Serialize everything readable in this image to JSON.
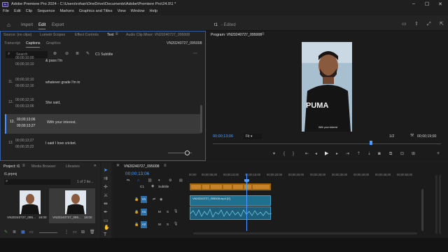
{
  "window": {
    "title": "Adobe Premiere Pro 2024 - C:\\Users\\rohan\\OneDrive\\Documents\\Adobe\\Premiere Pro\\24.0\\1 *",
    "minimize": "–",
    "maximize": "☐",
    "close": "✕"
  },
  "menu": [
    "File",
    "Edit",
    "Clip",
    "Sequence",
    "Markers",
    "Graphics and Titles",
    "View",
    "Window",
    "Help"
  ],
  "header": {
    "tabs": [
      "Import",
      "Edit",
      "Export"
    ],
    "active_tab": "Edit",
    "project_name": "t1",
    "project_status": "- Edited"
  },
  "source_panel": {
    "tabs": [
      "Source: (no clips)",
      "Lumetri Scopes",
      "Effect Controls",
      "Text",
      "Audio Clip Mixer: VN20240727_095008"
    ],
    "subtabs": [
      "Transcript",
      "Captions",
      "Graphics"
    ],
    "sequence": "VN20240727_095008",
    "search_placeholder": "Search",
    "track_label": "C1 Subtitle",
    "captions": [
      {
        "num": "",
        "in": "00;00;10;00",
        "out": "00;00;10;10",
        "text": "& pass I'm"
      },
      {
        "num": "11.",
        "in": "00;00;10;10",
        "out": "00;00;12;16",
        "text": "whatever grade I'm in"
      },
      {
        "num": "12.",
        "in": "00;00;12;16",
        "out": "00;00;13;06",
        "text": "She said,"
      },
      {
        "num": "12.",
        "in": "00;00;13;06",
        "out": "00;00;13;27",
        "text": "With your interest,"
      },
      {
        "num": "13.",
        "in": "00;00;13;27",
        "out": "00;00;15;22",
        "text": "I said I love cricket."
      }
    ]
  },
  "program": {
    "title": "Program: VN20240727_095008",
    "timecode": "00;00;13;06",
    "fit": "Fit",
    "quality": "1/2",
    "duration": "00;00;19;00",
    "video_caption": "With your interest",
    "shirt_brand": "PUMA"
  },
  "project_panel": {
    "tabs": [
      "Project: t1",
      "Media Browser",
      "Libraries"
    ],
    "file": "t1.prproj",
    "count": "1 of 2 ite...",
    "items": [
      {
        "name": "VN20240727_095...",
        "duration": "19:00"
      },
      {
        "name": "VN20240727_095...",
        "duration": "19:00"
      }
    ]
  },
  "timeline": {
    "sequence": "VN20240727_095008",
    "timecode": "00;00;13;06",
    "ruler": [
      "00;00",
      "00;00;05;00",
      "00;00;10;00",
      "00;00;15;00",
      "00;00;20;00",
      "00;00;25;00",
      "00;00;30;00",
      "00;00;35;00",
      "00;00;40;00",
      "00;00;45;00",
      "00;00;50;00"
    ],
    "tracks": [
      {
        "label": "C1",
        "name": "Subtitle"
      },
      {
        "label": "V1",
        "name": ""
      },
      {
        "label": "A1",
        "name": ""
      },
      {
        "label": "A2",
        "name": ""
      }
    ],
    "clip_name": "VN20240727_095008.mp4 [V]",
    "playhead_fraction": 0.24
  },
  "colors": {
    "accent": "#4f8fff",
    "clip_video": "#1f6f8f",
    "clip_subtitle": "#a0650f",
    "panel_bg": "#222222"
  }
}
